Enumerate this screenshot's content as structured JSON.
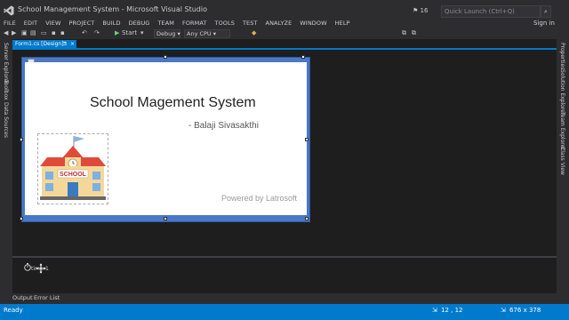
{
  "window": {
    "title": "School Management System - Microsoft Visual Studio",
    "notification_count": "16",
    "quick_launch_placeholder": "Quick Launch (Ctrl+Q)",
    "sign_in": "Sign in"
  },
  "menu": [
    "FILE",
    "EDIT",
    "VIEW",
    "PROJECT",
    "BUILD",
    "DEBUG",
    "TEAM",
    "FORMAT",
    "TOOLS",
    "TEST",
    "ANALYZE",
    "WINDOW",
    "HELP"
  ],
  "toolbar": {
    "start_label": "Start",
    "config": "Debug",
    "platform": "Any CPU"
  },
  "left_panels": [
    "Server Explorer",
    "Toolbox",
    "Data Sources"
  ],
  "right_panels": [
    "Properties",
    "Solution Explorer",
    "Team Explorer",
    "Class View"
  ],
  "document_tab": {
    "label": "Form1.cs [Design]*",
    "pin": "⊐",
    "close": "×"
  },
  "form": {
    "title_text": "School Magement System",
    "author": "- Balaji Sivasakthi",
    "powered_by": "Powered by Latrosoft",
    "image_sign": "SCHOOL"
  },
  "tray": {
    "component_label": "timer1"
  },
  "bottom_tabs": [
    "Output",
    "Error List"
  ],
  "status": {
    "left": "Ready",
    "position": "12 , 12",
    "size": "676 x 378"
  },
  "colors": {
    "accent": "#007acc",
    "chrome": "#2d2d30",
    "editor_bg": "#1e1e1e",
    "form_border": "#4a78c8"
  }
}
